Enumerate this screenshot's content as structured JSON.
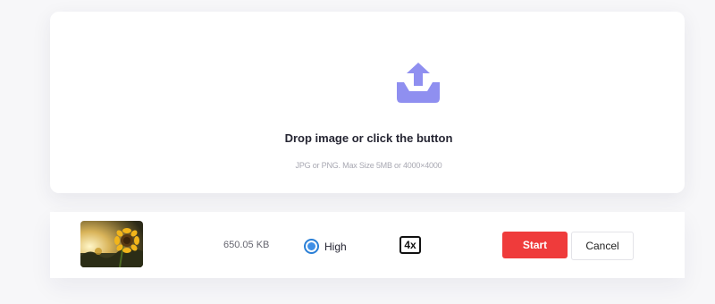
{
  "dropzone": {
    "icon": "upload-tray-icon",
    "title": "Drop image or click the button",
    "hint": "JPG or PNG. Max Size 5MB or 4000×4000"
  },
  "file": {
    "thumbnail": "sunflower-photo",
    "size": "650.05 KB",
    "quality": "High",
    "scale": "4x"
  },
  "actions": {
    "start": "Start",
    "cancel": "Cancel"
  },
  "colors": {
    "accent_icon": "#8f8ff0",
    "start_button": "#ef3b3b",
    "radio": "#3f8fe6"
  }
}
